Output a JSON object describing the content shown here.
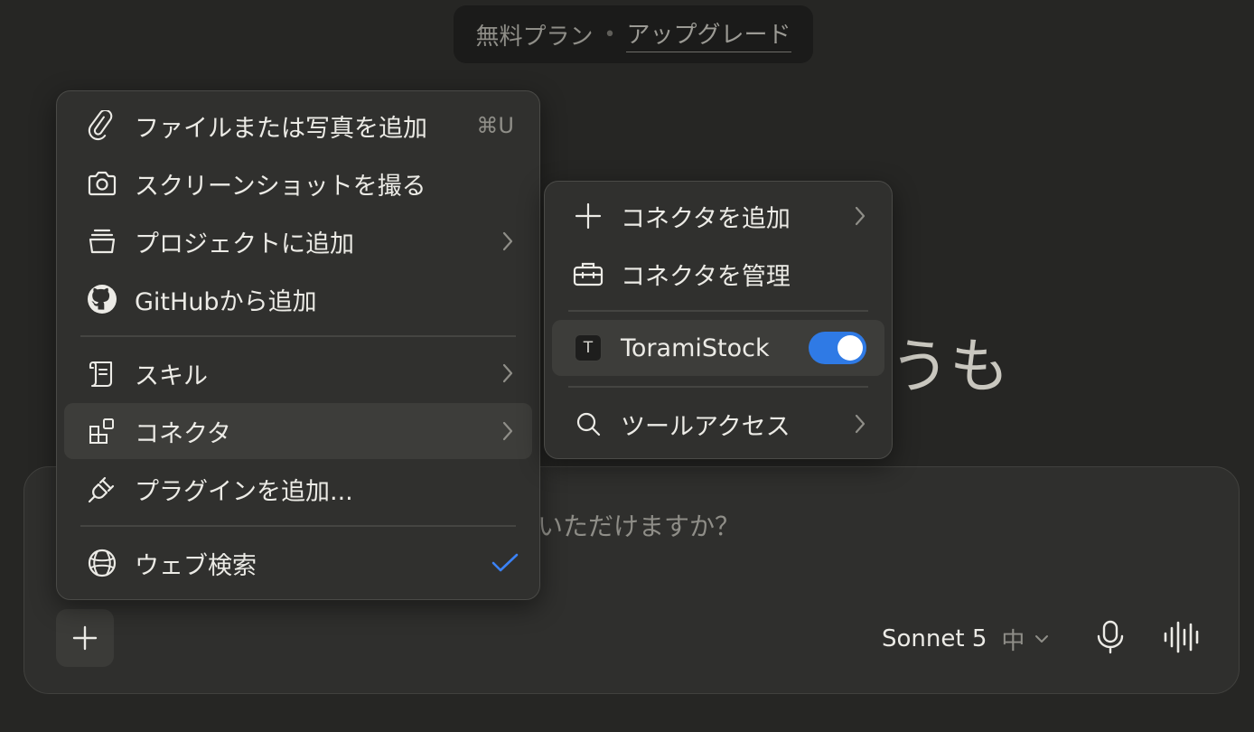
{
  "plan_banner": {
    "plan": "無料プラン",
    "separator": "•",
    "upgrade": "アップグレード"
  },
  "greeting": {
    "visible_text": "うも"
  },
  "composer": {
    "placeholder_visible": "いただけますか？",
    "model": "Sonnet 5",
    "effort": "中"
  },
  "main_menu": {
    "items": [
      {
        "label": "ファイルまたは写真を追加",
        "shortcut": "⌘U",
        "icon": "paperclip-icon"
      },
      {
        "label": "スクリーンショットを撮る",
        "icon": "camera-icon"
      },
      {
        "label": "プロジェクトに追加",
        "icon": "project-icon",
        "has_submenu": true
      },
      {
        "label": "GitHubから追加",
        "icon": "github-icon"
      },
      {
        "label": "スキル",
        "icon": "scroll-icon",
        "has_submenu": true
      },
      {
        "label": "コネクタ",
        "icon": "connector-icon",
        "has_submenu": true,
        "active": true
      },
      {
        "label": "プラグインを追加...",
        "icon": "plug-icon"
      },
      {
        "label": "ウェブ検索",
        "icon": "globe-icon",
        "checked": true
      }
    ]
  },
  "connector_submenu": {
    "add_label": "コネクタを追加",
    "manage_label": "コネクタを管理",
    "connector_name": "ToramiStock",
    "connector_initial": "T",
    "connector_enabled": true,
    "tool_access_label": "ツールアクセス"
  },
  "colors": {
    "background": "#262624",
    "menu": "#30302e",
    "toggle_on": "#2f7ae5",
    "check": "#3b82f6"
  }
}
